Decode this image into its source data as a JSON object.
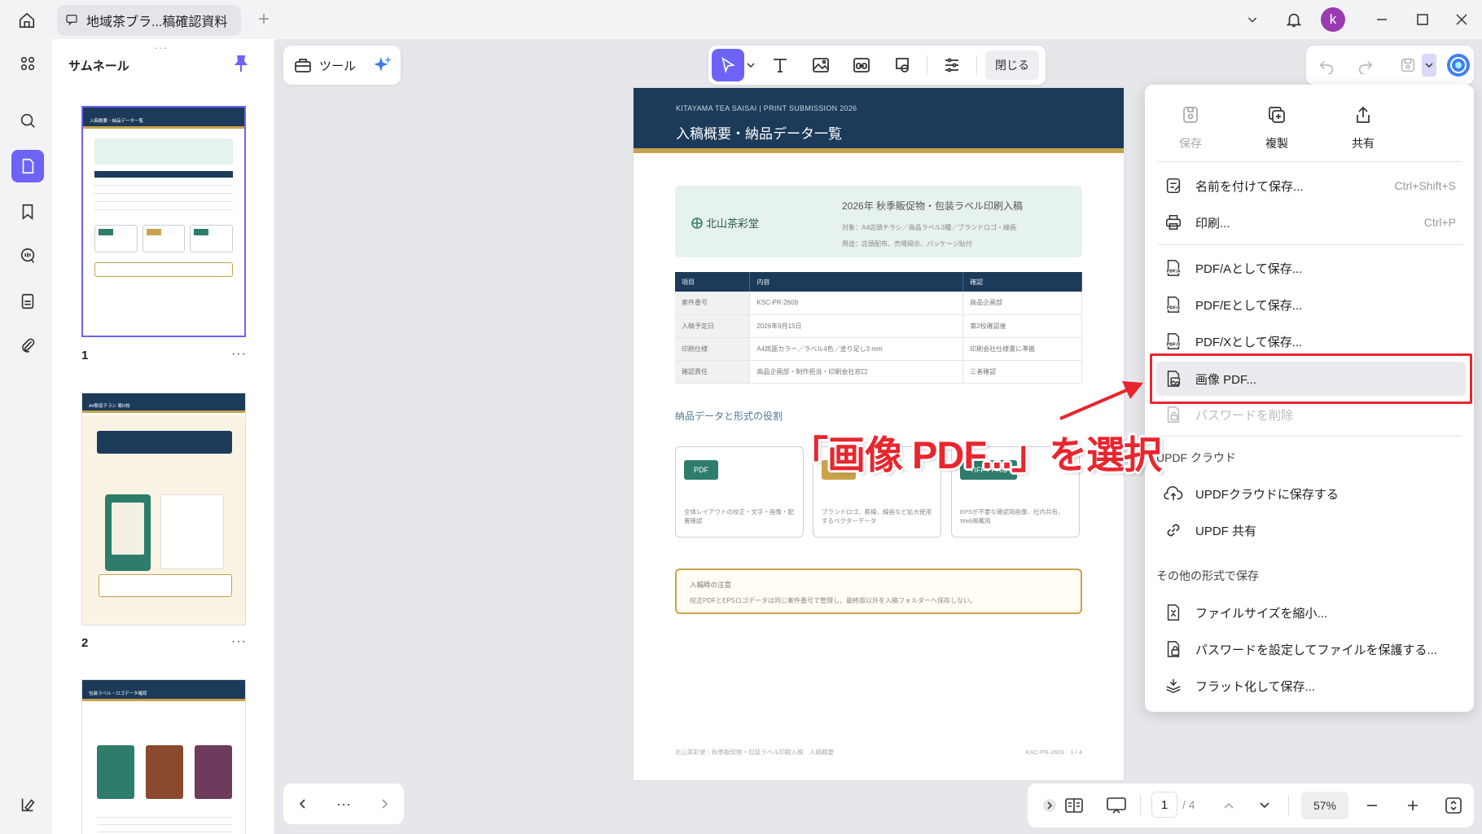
{
  "titlebar": {
    "tab_title": "地域茶ブラ...稿確認資料",
    "avatar_letter": "k"
  },
  "thumbnails": {
    "panel_title": "サムネール",
    "pages": [
      {
        "number": "1",
        "title": "入稿概要・納品データ一覧"
      },
      {
        "number": "2",
        "title": "A4販促チラシ 案D校"
      },
      {
        "number": "",
        "title": "包装ラベル・ロゴデータ確認"
      }
    ],
    "more": "···"
  },
  "toolbar": {
    "tools_label": "ツール",
    "close_label": "閉じる"
  },
  "document": {
    "header_small": "KITAYAMA TEA SAISAI | PRINT SUBMISSION 2026",
    "header_title": "入稿概要・納品データ一覧",
    "brand": "北山茶彩堂",
    "info_title": "2026年 秋季販促物・包装ラベル印刷入稿",
    "info_line1": "対象：A4店頭チラシ／商品ラベル3種／ブランドロゴ・線画",
    "info_line2": "用途：店頭配布、売場掲示、パッケージ貼付",
    "table": {
      "headers": [
        "項目",
        "内容",
        "確認"
      ],
      "rows": [
        [
          "案件番号",
          "KSC-PR-2609",
          "商品企画部"
        ],
        [
          "入稿予定日",
          "2026年9月15日",
          "第2校確認後"
        ],
        [
          "印刷仕様",
          "A4両面カラー／ラベル4色／塗り足し3 mm",
          "印刷会社仕様書に準拠"
        ],
        [
          "確認責任",
          "商品企画部・制作担当・印刷会社窓口",
          "三者確認"
        ]
      ]
    },
    "section_title": "納品データと形式の役割",
    "cards": [
      {
        "tag": "PDF",
        "text": "全体レイアウトの校正・文字・画像・配置確認"
      },
      {
        "tag": "EPS",
        "text": "ブランドロゴ、罫線、線画など拡大使用するベクターデータ"
      },
      {
        "tag": "TIFF / PNG",
        "text": "EPSが不要な確認用画像、社内共有、Web掲載用"
      }
    ],
    "note_title": "入稿時の注意",
    "note_text": "校正PDFとEPSロゴデータは同じ案件番号で管理し、最終版以外を入稿フォルダーへ保存しない。",
    "footer_left": "北山茶彩堂｜秋季販促物・包装ラベル印刷入稿　入稿概要",
    "footer_right": "KSC-PR-2609　1 / 4"
  },
  "menu": {
    "top": [
      {
        "label": "保存",
        "icon": "save-icon"
      },
      {
        "label": "複製",
        "icon": "duplicate-icon"
      },
      {
        "label": "共有",
        "icon": "share-icon"
      }
    ],
    "items": [
      {
        "label": "名前を付けて保存...",
        "shortcut": "Ctrl+Shift+S"
      },
      {
        "label": "印刷...",
        "shortcut": "Ctrl+P"
      },
      {
        "label": "PDF/Aとして保存..."
      },
      {
        "label": "PDF/Eとして保存..."
      },
      {
        "label": "PDF/Xとして保存..."
      },
      {
        "label": "画像 PDF..."
      },
      {
        "label": "パスワードを削除"
      }
    ],
    "cloud_section": "UPDF クラウド",
    "cloud_items": [
      {
        "label": "UPDFクラウドに保存する"
      },
      {
        "label": "UPDF 共有"
      }
    ],
    "other_section": "その他の形式で保存",
    "other_items": [
      {
        "label": "ファイルサイズを縮小..."
      },
      {
        "label": "パスワードを設定してファイルを保護する..."
      },
      {
        "label": "フラット化して保存..."
      }
    ]
  },
  "annotation": {
    "callout": "「画像 PDF...」を選択",
    "color": "#e8262e"
  },
  "bottombar": {
    "more": "···",
    "page_current": "1",
    "page_total": "/ 4",
    "zoom": "57%"
  },
  "colors": {
    "accent": "#6d63f6",
    "doc_navy": "#1c3a59",
    "doc_gold": "#c9a34c",
    "doc_green": "#2e7d6b"
  }
}
